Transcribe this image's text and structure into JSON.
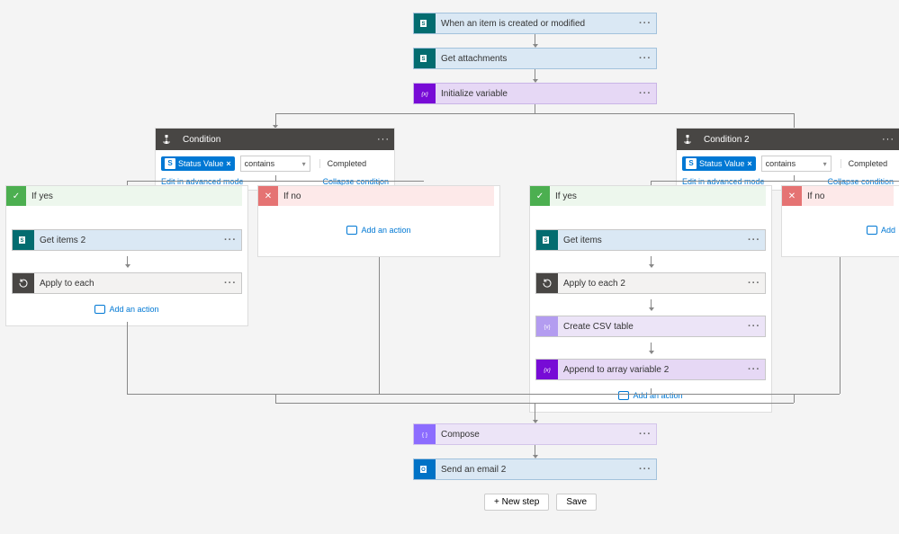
{
  "flow": {
    "trigger": {
      "label": "When an item is created or modified"
    },
    "get_attachments": {
      "label": "Get attachments"
    },
    "init_var": {
      "label": "Initialize variable"
    },
    "condition1": {
      "title": "Condition",
      "tag": "Status Value",
      "operator": "contains",
      "value_label": "Completed",
      "edit_link": "Edit in advanced mode",
      "collapse_link": "Collapse condition"
    },
    "condition2": {
      "title": "Condition 2",
      "tag": "Status Value",
      "operator": "contains",
      "value_label": "Completed",
      "edit_link": "Edit in advanced mode",
      "collapse_link": "Collapse condition"
    },
    "branch1_yes": {
      "title": "If yes",
      "steps": [
        {
          "label": "Get items 2"
        },
        {
          "label": "Apply to each"
        }
      ]
    },
    "branch1_no": {
      "title": "If no"
    },
    "branch2_yes": {
      "title": "If yes",
      "steps": [
        {
          "label": "Get items"
        },
        {
          "label": "Apply to each 2"
        },
        {
          "label": "Create CSV table"
        },
        {
          "label": "Append to array variable 2"
        }
      ]
    },
    "branch2_no": {
      "title": "If no",
      "add_label": "Add"
    },
    "compose": {
      "label": "Compose"
    },
    "send_email": {
      "label": "Send an email 2"
    },
    "add_action_label": "Add an action",
    "new_step": "+ New step",
    "save": "Save"
  }
}
